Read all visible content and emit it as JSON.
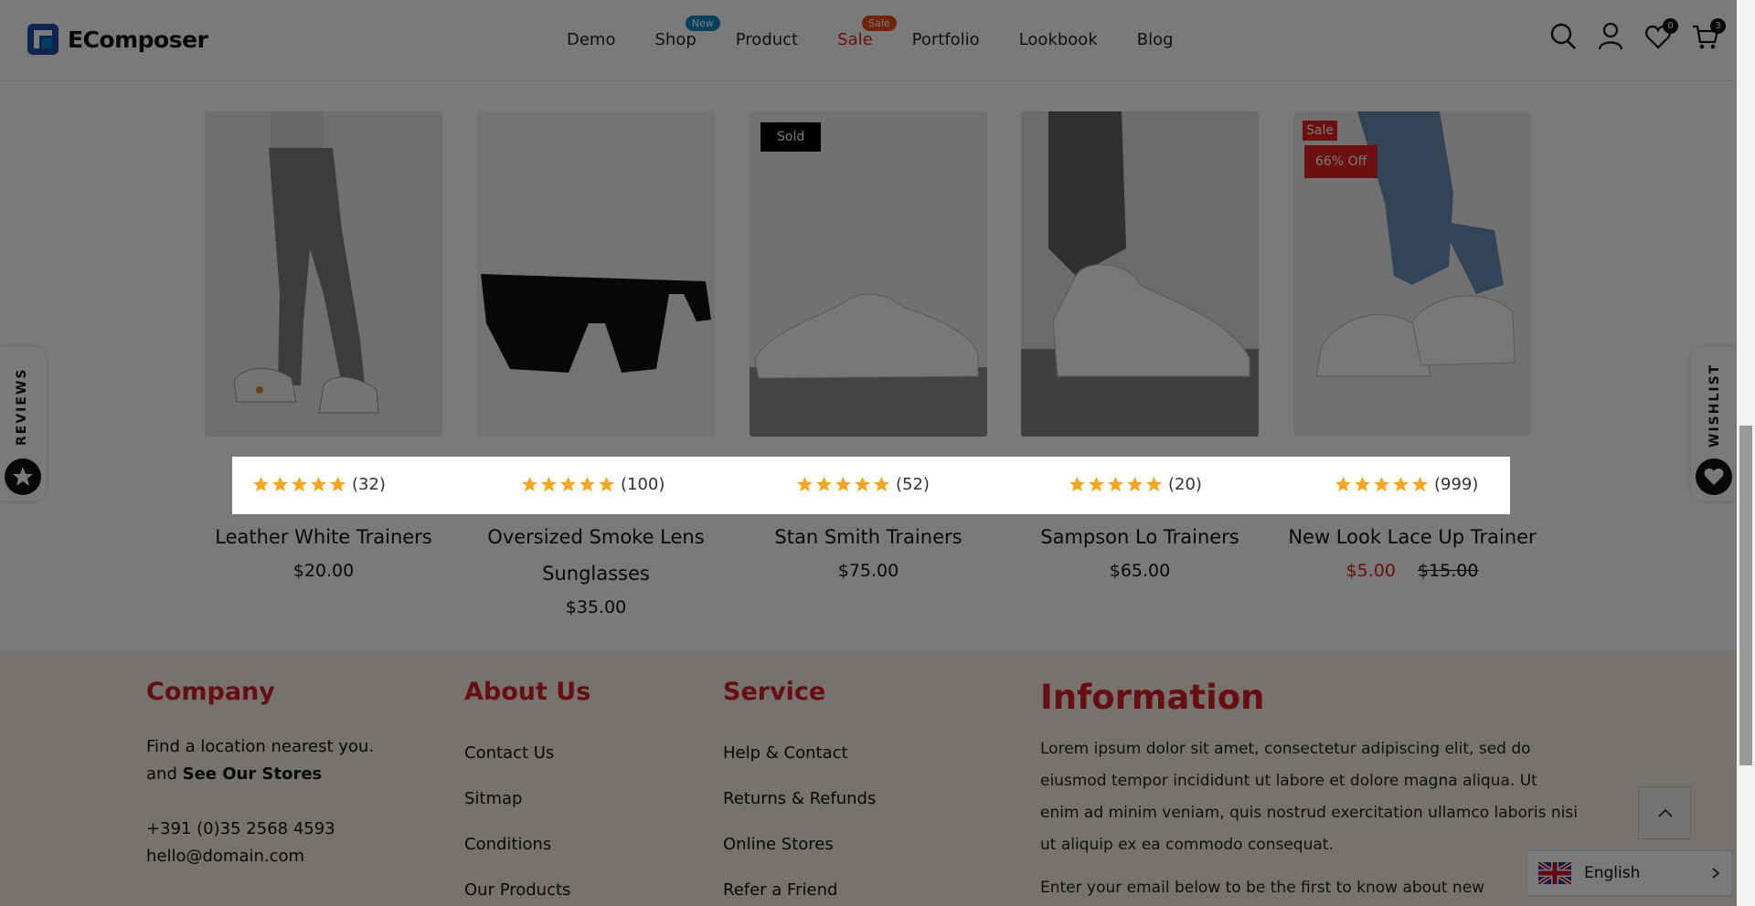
{
  "brand": {
    "name": "EComposer"
  },
  "nav": {
    "items": [
      {
        "label": "Demo"
      },
      {
        "label": "Shop",
        "badge": "New"
      },
      {
        "label": "Product"
      },
      {
        "label": "Sale",
        "badge": "Sale"
      },
      {
        "label": "Portfolio"
      },
      {
        "label": "Lookbook"
      },
      {
        "label": "Blog"
      }
    ]
  },
  "header": {
    "wishlist_count": "0",
    "cart_count": "3"
  },
  "products": [
    {
      "name": "Leather White Trainers",
      "price": "$20.00",
      "reviews": "(32)",
      "rating": 5
    },
    {
      "name": "Oversized Smoke Lens Sunglasses",
      "price": "$35.00",
      "reviews": "(100)",
      "rating": 5
    },
    {
      "name": "Stan Smith Trainers",
      "price": "$75.00",
      "reviews": "(52)",
      "rating": 5,
      "tag": "Sold"
    },
    {
      "name": "Sampson Lo Trainers",
      "price": "$65.00",
      "reviews": "(20)",
      "rating": 5
    },
    {
      "name": "New Look Lace Up Trainer",
      "price": "$5.00",
      "old_price": "$15.00",
      "reviews": "(999)",
      "rating": 5,
      "tag": "Sale",
      "discount": "66% Off"
    }
  ],
  "footer": {
    "company": {
      "title": "Company",
      "line1": "Find a location nearest you.",
      "line2_prefix": "and",
      "line2_bold": "See Our Stores",
      "phone": "+391 (0)35 2568 4593",
      "email": "hello@domain.com"
    },
    "about": {
      "title": "About Us",
      "links": [
        "Contact Us",
        "Sitmap",
        "Conditions",
        "Our Products"
      ]
    },
    "service": {
      "title": "Service",
      "links": [
        "Help & Contact",
        "Returns & Refunds",
        "Online Stores",
        "Refer a Friend"
      ]
    },
    "information": {
      "title": "Information",
      "text": "Lorem ipsum dolor sit amet, consectetur adipiscing elit, sed do eiusmod tempor incididunt ut labore et dolore magna aliqua. Ut enim ad minim veniam, quis nostrud exercitation ullamco laboris nisi ut aliquip ex ea commodo consequat.",
      "subscribe": "Enter your email below to be the first to know about new"
    }
  },
  "side": {
    "reviews_label": "REVIEWS",
    "wishlist_label": "WISHLIST"
  },
  "language": {
    "label": "English"
  },
  "colors": {
    "accent": "#d81f26",
    "star": "#f5a623",
    "badge_new": "#0c87c5",
    "badge_sale": "#ee4b12"
  }
}
